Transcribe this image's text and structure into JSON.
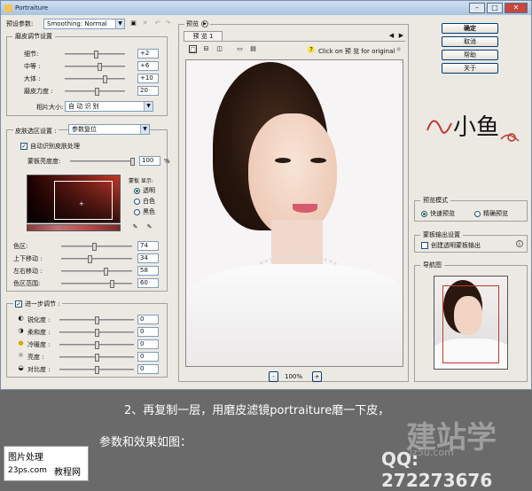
{
  "window": {
    "title": "Portraiture"
  },
  "preset": {
    "label": "预设参数:",
    "value": "Smoothing: Normal"
  },
  "smoothing": {
    "title": "磨皮调节设置",
    "rows": [
      {
        "label": "细节:",
        "value": "+2"
      },
      {
        "label": "中等 :",
        "value": "+6"
      },
      {
        "label": "大体 :",
        "value": "+10"
      },
      {
        "label": "磨皮力度 :",
        "value": "20"
      }
    ],
    "size_label": "相片大小:",
    "size_value": "自 动 识 别"
  },
  "skin": {
    "title": "皮肤选区设置 :",
    "reset_value": "参数复位",
    "auto_label": "自动识别皮肤处理",
    "brightness_label": "蒙板亮度度:",
    "brightness_value": "100",
    "percent": "%",
    "mask_label": "蒙板 显示:",
    "mask_options": [
      "透明",
      "白色",
      "黑色"
    ],
    "rows": [
      {
        "label": "色区:",
        "value": "74"
      },
      {
        "label": "上下移动 :",
        "value": "34"
      },
      {
        "label": "左右移动 :",
        "value": "58"
      },
      {
        "label": "色区范围:",
        "value": "60"
      }
    ]
  },
  "enhance": {
    "title": "进一步调节 :",
    "rows": [
      {
        "label": "锐化度 :",
        "value": "0"
      },
      {
        "label": "柔和度 :",
        "value": "0"
      },
      {
        "label": "冷暖度 :",
        "value": "0"
      },
      {
        "label": "亮度 :",
        "value": "0"
      },
      {
        "label": "对比度 :",
        "value": "0"
      }
    ]
  },
  "preview": {
    "title": "预览",
    "tab": "预 览 1",
    "click_text": "Click on 预 览 for original",
    "help": "?",
    "zoom": "100%",
    "minus": "-",
    "plus": "+"
  },
  "buttons": {
    "ok": "确定",
    "cancel": "取消",
    "help": "帮助",
    "about": "关于"
  },
  "logo": {
    "text": "小鱼"
  },
  "preview_mode": {
    "title": "预览模式",
    "options": [
      "快速预览",
      "精确预览"
    ]
  },
  "mask_output": {
    "title": "蒙板输出设置",
    "label": "创建透明蒙板输出"
  },
  "navigator": {
    "title": "导航图"
  },
  "caption": {
    "line1": "2、再复制一层，用磨皮滤镜portraiture磨一下皮，",
    "line2": "参数和效果如图：",
    "qq": "QQ: 272273676",
    "watermark_left_1": "图片处理",
    "watermark_left_2": "23ps.com",
    "watermark_left_3": "教程网",
    "watermark_right": "建站学",
    "watermark_right_url": "jz5u.com"
  }
}
